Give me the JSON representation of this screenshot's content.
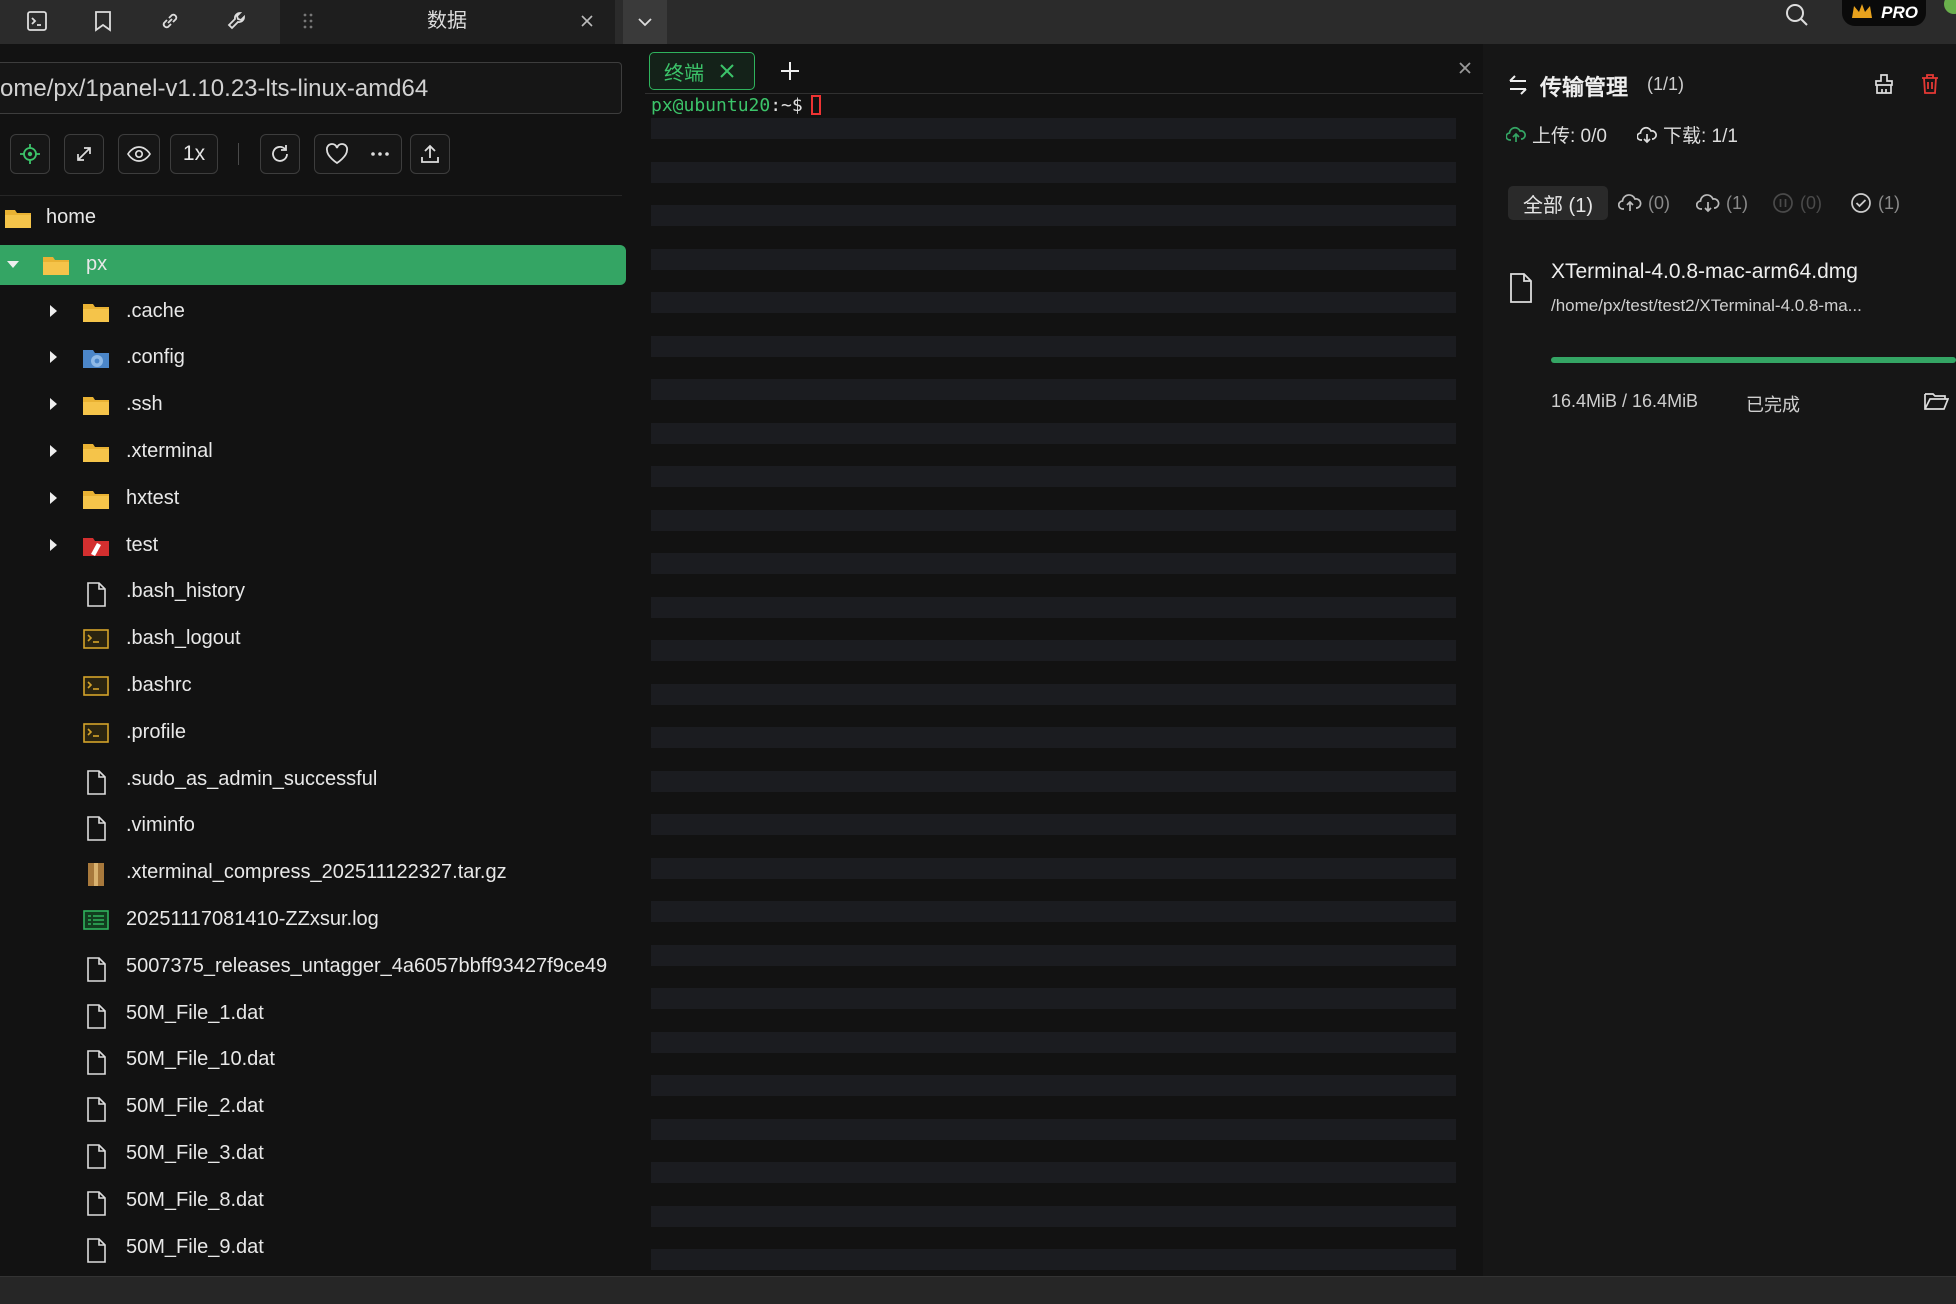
{
  "top_tab": {
    "title": "数据"
  },
  "top_right": {
    "badge": "PRO"
  },
  "left_panel": {
    "path": "ome/px/1panel-v1.10.23-lts-linux-amd64",
    "speed": "1x",
    "tree": [
      {
        "name": "home",
        "type": "folder",
        "level": 0
      },
      {
        "name": "px",
        "type": "folder",
        "level": 1,
        "expanded": true,
        "selected": true
      },
      {
        "name": ".cache",
        "type": "folder",
        "level": 2
      },
      {
        "name": ".config",
        "type": "config-folder",
        "level": 2
      },
      {
        "name": ".ssh",
        "type": "folder",
        "level": 2
      },
      {
        "name": ".xterminal",
        "type": "folder",
        "level": 2
      },
      {
        "name": "hxtest",
        "type": "folder",
        "level": 2
      },
      {
        "name": "test",
        "type": "test-folder",
        "level": 2
      },
      {
        "name": ".bash_history",
        "type": "file",
        "level": 2
      },
      {
        "name": ".bash_logout",
        "type": "shell",
        "level": 2
      },
      {
        "name": ".bashrc",
        "type": "shell",
        "level": 2
      },
      {
        "name": ".profile",
        "type": "shell",
        "level": 2
      },
      {
        "name": ".sudo_as_admin_successful",
        "type": "file",
        "level": 2
      },
      {
        "name": ".viminfo",
        "type": "file",
        "level": 2
      },
      {
        "name": ".xterminal_compress_202511122327.tar.gz",
        "type": "archive",
        "level": 2
      },
      {
        "name": "20251117081410-ZZxsur.log",
        "type": "log",
        "level": 2
      },
      {
        "name": "5007375_releases_untagger_4a6057bbff93427f9ce49",
        "type": "file",
        "level": 2
      },
      {
        "name": "50M_File_1.dat",
        "type": "file",
        "level": 2
      },
      {
        "name": "50M_File_10.dat",
        "type": "file",
        "level": 2
      },
      {
        "name": "50M_File_2.dat",
        "type": "file",
        "level": 2
      },
      {
        "name": "50M_File_3.dat",
        "type": "file",
        "level": 2
      },
      {
        "name": "50M_File_8.dat",
        "type": "file",
        "level": 2
      },
      {
        "name": "50M_File_9.dat",
        "type": "file",
        "level": 2
      }
    ]
  },
  "terminal": {
    "tab_label": "终端",
    "prompt_user": "px@ubuntu20",
    "prompt_rest": ":~$"
  },
  "transfer": {
    "title": "传输管理",
    "count": "(1/1)",
    "upload_label": "上传: 0/0",
    "download_label": "下载: 1/1",
    "filters": {
      "all": "全部 (1)",
      "upload": "(0)",
      "download": "(1)",
      "paused": "(0)",
      "done": "(1)"
    },
    "item": {
      "filename": "XTerminal-4.0.8-mac-arm64.dmg",
      "path": "/home/px/test/test2/XTerminal-4.0.8-ma...",
      "size": "16.4MiB / 16.4MiB",
      "status": "已完成",
      "progress": 1.0
    }
  },
  "colors": {
    "accent": "#34a564",
    "danger": "#e53935"
  }
}
